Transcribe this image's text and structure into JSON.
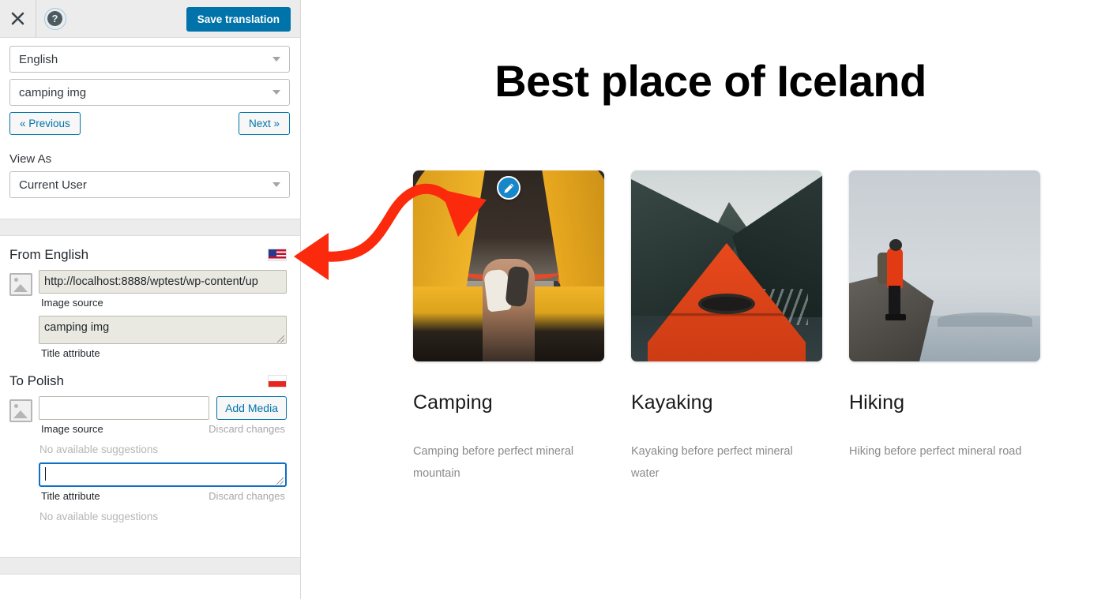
{
  "sidebar": {
    "topbar": {
      "close_icon": "close-icon",
      "help_icon": "help-icon",
      "help_glyph": "?",
      "save_label": "Save translation",
      "accent_color": "#0073aa"
    },
    "language_select": {
      "value": "English"
    },
    "string_select": {
      "value": "camping img"
    },
    "nav": {
      "previous_label": "« Previous",
      "next_label": "Next »"
    },
    "view_as": {
      "label": "View As",
      "value": "Current User"
    },
    "source": {
      "heading": "From English",
      "flag": "flag-us-icon",
      "image_source_value": "http://localhost:8888/wptest/wp-content/up",
      "image_source_label": "Image source",
      "title_attribute_value": "camping img",
      "title_attribute_label": "Title attribute",
      "image_placeholder_icon": "image-placeholder-icon"
    },
    "target": {
      "heading": "To Polish",
      "flag": "flag-pl-icon",
      "image_source_value": "",
      "image_source_label": "Image source",
      "add_media_label": "Add Media",
      "discard_label_1": "Discard changes",
      "suggestions_1": "No available suggestions",
      "title_attribute_value": "",
      "title_attribute_label": "Title attribute",
      "discard_label_2": "Discard changes",
      "suggestions_2": "No available suggestions",
      "image_placeholder_icon": "image-placeholder-icon"
    }
  },
  "preview": {
    "hero_title": "Best place of Iceland",
    "edit_badge_icon": "pencil-edit-icon",
    "annotation": {
      "type": "double-headed-curved-arrow",
      "color": "#fb2a0c"
    },
    "cards": [
      {
        "image": "camping-image",
        "title": "Camping",
        "description": "Camping before perfect mineral mountain",
        "has_edit_badge": true
      },
      {
        "image": "kayaking-image",
        "title": "Kayaking",
        "description": "Kayaking before perfect mineral water",
        "has_edit_badge": false
      },
      {
        "image": "hiking-image",
        "title": "Hiking",
        "description": "Hiking before perfect mineral road",
        "has_edit_badge": false
      }
    ]
  }
}
